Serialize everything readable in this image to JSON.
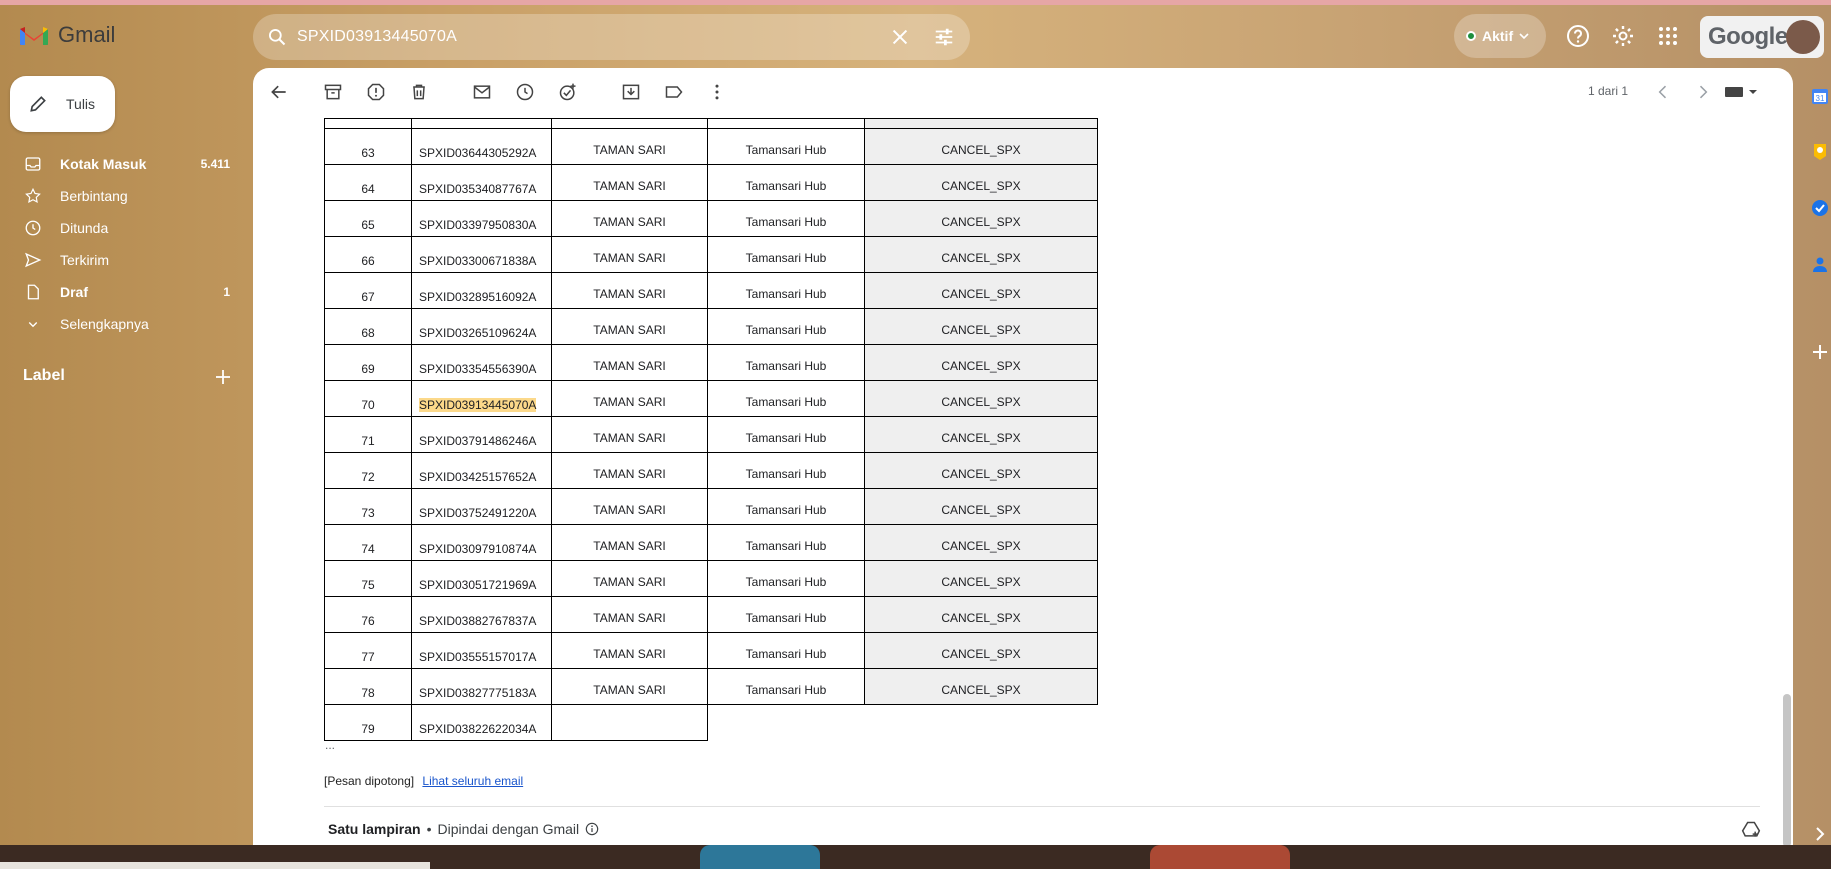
{
  "app": {
    "name": "Gmail"
  },
  "search": {
    "query": "SPXID03913445070A"
  },
  "status": {
    "label": "Aktif"
  },
  "account": {
    "brand": "Google"
  },
  "compose": {
    "label": "Tulis"
  },
  "sidebar": {
    "items": [
      {
        "label": "Kotak Masuk",
        "count": "5.411",
        "icon": "inbox-icon",
        "bold": true
      },
      {
        "label": "Berbintang",
        "count": "",
        "icon": "star-icon",
        "bold": false
      },
      {
        "label": "Ditunda",
        "count": "",
        "icon": "clock-icon",
        "bold": false
      },
      {
        "label": "Terkirim",
        "count": "",
        "icon": "send-icon",
        "bold": false
      },
      {
        "label": "Draf",
        "count": "1",
        "icon": "draft-icon",
        "bold": true
      },
      {
        "label": "Selengkapnya",
        "count": "",
        "icon": "chevron-down-icon",
        "bold": false
      }
    ],
    "labels_heading": "Label"
  },
  "toolbar": {
    "pager": "1 dari 1"
  },
  "table": {
    "rows": [
      {
        "no": "63",
        "id": "SPXID03644305292A",
        "kecamatan": "TAMAN SARI",
        "hub": "Tamansari Hub",
        "status": "CANCEL_SPX"
      },
      {
        "no": "64",
        "id": "SPXID03534087767A",
        "kecamatan": "TAMAN SARI",
        "hub": "Tamansari Hub",
        "status": "CANCEL_SPX"
      },
      {
        "no": "65",
        "id": "SPXID03397950830A",
        "kecamatan": "TAMAN SARI",
        "hub": "Tamansari Hub",
        "status": "CANCEL_SPX"
      },
      {
        "no": "66",
        "id": "SPXID03300671838A",
        "kecamatan": "TAMAN SARI",
        "hub": "Tamansari Hub",
        "status": "CANCEL_SPX"
      },
      {
        "no": "67",
        "id": "SPXID03289516092A",
        "kecamatan": "TAMAN SARI",
        "hub": "Tamansari Hub",
        "status": "CANCEL_SPX"
      },
      {
        "no": "68",
        "id": "SPXID03265109624A",
        "kecamatan": "TAMAN SARI",
        "hub": "Tamansari Hub",
        "status": "CANCEL_SPX"
      },
      {
        "no": "69",
        "id": "SPXID03354556390A",
        "kecamatan": "TAMAN SARI",
        "hub": "Tamansari Hub",
        "status": "CANCEL_SPX"
      },
      {
        "no": "70",
        "id": "SPXID03913445070A",
        "kecamatan": "TAMAN SARI",
        "hub": "Tamansari Hub",
        "status": "CANCEL_SPX"
      },
      {
        "no": "71",
        "id": "SPXID03791486246A",
        "kecamatan": "TAMAN SARI",
        "hub": "Tamansari Hub",
        "status": "CANCEL_SPX"
      },
      {
        "no": "72",
        "id": "SPXID03425157652A",
        "kecamatan": "TAMAN SARI",
        "hub": "Tamansari Hub",
        "status": "CANCEL_SPX"
      },
      {
        "no": "73",
        "id": "SPXID03752491220A",
        "kecamatan": "TAMAN SARI",
        "hub": "Tamansari Hub",
        "status": "CANCEL_SPX"
      },
      {
        "no": "74",
        "id": "SPXID03097910874A",
        "kecamatan": "TAMAN SARI",
        "hub": "Tamansari Hub",
        "status": "CANCEL_SPX"
      },
      {
        "no": "75",
        "id": "SPXID03051721969A",
        "kecamatan": "TAMAN SARI",
        "hub": "Tamansari Hub",
        "status": "CANCEL_SPX"
      },
      {
        "no": "76",
        "id": "SPXID03882767837A",
        "kecamatan": "TAMAN SARI",
        "hub": "Tamansari Hub",
        "status": "CANCEL_SPX"
      },
      {
        "no": "77",
        "id": "SPXID03555157017A",
        "kecamatan": "TAMAN SARI",
        "hub": "Tamansari Hub",
        "status": "CANCEL_SPX"
      },
      {
        "no": "78",
        "id": "SPXID03827775183A",
        "kecamatan": "TAMAN SARI",
        "hub": "Tamansari Hub",
        "status": "CANCEL_SPX"
      },
      {
        "no": "79",
        "id": "SPXID03822622034A",
        "kecamatan": "",
        "hub": "",
        "status": ""
      }
    ]
  },
  "message": {
    "ellipsis": "...",
    "truncated_label": "[Pesan dipotong]",
    "view_full_link": "Lihat seluruh email",
    "attachment_title": "Satu lampiran",
    "separator": "•",
    "scanned_label": "Dipindai dengan Gmail"
  }
}
